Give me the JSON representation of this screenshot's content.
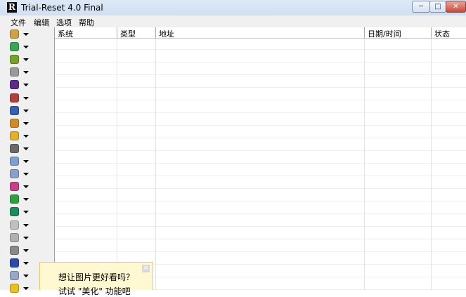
{
  "window": {
    "app_icon_letter": "R",
    "title": "Trial-Reset 4.0 Final",
    "minimize_glyph": "─",
    "maximize_glyph": "□",
    "close_glyph": "✕"
  },
  "menu": [
    "文件",
    "编辑",
    "选项",
    "帮助"
  ],
  "toolbar": {
    "buttons": [
      {
        "icon": "package-icon",
        "color": "#c9a24a"
      },
      {
        "icon": "shield-color-icon",
        "color": "#3aa655"
      },
      {
        "icon": "key-icon",
        "color": "#7a9f2a"
      },
      {
        "icon": "cube-icon",
        "color": "#9a9a9a"
      },
      {
        "icon": "book-icon",
        "color": "#5b2c8a"
      },
      {
        "icon": "registry-icon",
        "color": "#b04040"
      },
      {
        "icon": "globe-icon",
        "color": "#3a5fb0"
      },
      {
        "icon": "puzzle-icon",
        "color": "#d08a2a"
      },
      {
        "icon": "folder-key-icon",
        "color": "#e0b030"
      },
      {
        "icon": "gear-icon",
        "color": "#6a6a6a"
      },
      {
        "icon": "document-icon",
        "color": "#7f9fcf"
      },
      {
        "icon": "chart-icon",
        "color": "#8aa0c8"
      },
      {
        "icon": "search-icon",
        "color": "#c8408a"
      },
      {
        "icon": "shield-icon",
        "color": "#2fa03f"
      },
      {
        "icon": "medal-icon",
        "color": "#1f8a5f"
      },
      {
        "icon": "feather-icon",
        "color": "#c0c0c0"
      },
      {
        "icon": "star-icon",
        "color": "#b0b0b0"
      },
      {
        "icon": "lock-icon",
        "color": "#8a8a8a"
      },
      {
        "icon": "security-icon",
        "color": "#2c4aa8"
      },
      {
        "icon": "bottle-icon",
        "color": "#9aa8c8"
      },
      {
        "icon": "warning-icon",
        "color": "#e8c020"
      }
    ]
  },
  "list": {
    "columns": [
      "系统",
      "类型",
      "地址",
      "日期/时间",
      "状态"
    ],
    "rows": []
  },
  "tooltip": {
    "line1": "想让图片更好看吗？",
    "line2": "试试 \"美化\" 功能吧",
    "close_glyph": "✕"
  },
  "colors": {
    "tooltip_bg": "#fff8d2",
    "window_chrome": "#dde9f7"
  }
}
